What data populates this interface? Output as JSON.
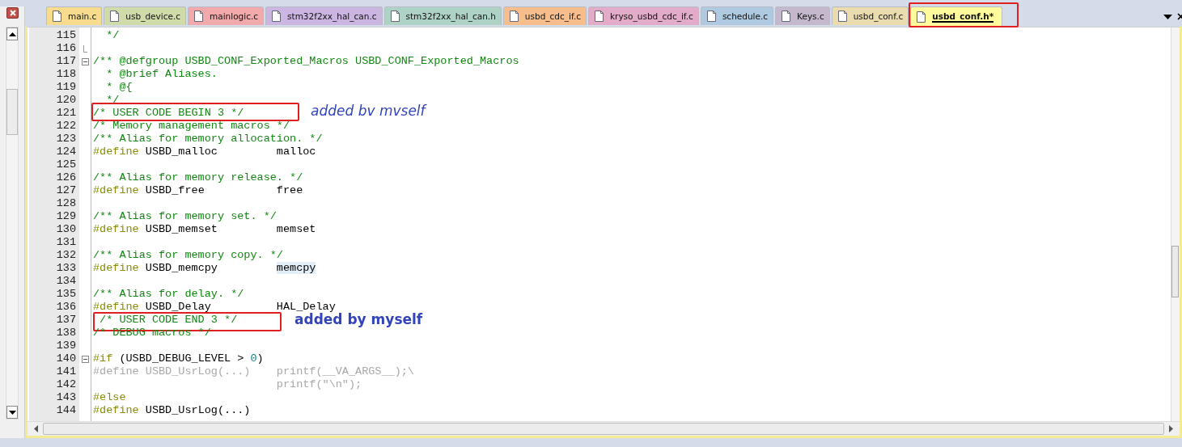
{
  "tabs": [
    {
      "label": "main.c",
      "color": "#f6dc8c",
      "selected": false,
      "marked": false
    },
    {
      "label": "usb_device.c",
      "color": "#cfdcaa",
      "selected": false,
      "marked": false
    },
    {
      "label": "mainlogic.c",
      "color": "#f2a9ab",
      "selected": false,
      "marked": false
    },
    {
      "label": "stm32f2xx_hal_can.c",
      "color": "#cbb6e2",
      "selected": false,
      "marked": false
    },
    {
      "label": "stm32f2xx_hal_can.h",
      "color": "#aed3c6",
      "selected": false,
      "marked": false
    },
    {
      "label": "usbd_cdc_if.c",
      "color": "#f7bd8a",
      "selected": false,
      "marked": false
    },
    {
      "label": "kryso_usbd_cdc_if.c",
      "color": "#e2acc8",
      "selected": false,
      "marked": false
    },
    {
      "label": "schedule.c",
      "color": "#aec9e0",
      "selected": false,
      "marked": false
    },
    {
      "label": "Keys.c",
      "color": "#c6b8cc",
      "selected": false,
      "marked": false
    },
    {
      "label": "usbd_conf.c",
      "color": "#eadcae",
      "selected": false,
      "marked": false
    },
    {
      "label": "usbd_conf.h*",
      "color": "#fdfb9c",
      "selected": true,
      "marked": true
    }
  ],
  "lines": [
    {
      "number": "115",
      "tokens": [
        {
          "kind": "comment",
          "text": "  */"
        }
      ]
    },
    {
      "number": "116",
      "fold_end": true
    },
    {
      "number": "117",
      "fold_start": true,
      "tokens": [
        {
          "kind": "comment",
          "text": "/** @defgroup USBD_CONF_Exported_Macros USBD_CONF_Exported_Macros"
        }
      ]
    },
    {
      "number": "118",
      "tokens": [
        {
          "kind": "comment",
          "text": "  * @brief Aliases."
        }
      ]
    },
    {
      "number": "119",
      "tokens": [
        {
          "kind": "comment",
          "text": "  * @{"
        }
      ]
    },
    {
      "number": "120",
      "tokens": [
        {
          "kind": "comment",
          "text": "  */"
        }
      ]
    },
    {
      "number": "121",
      "tokens": [
        {
          "kind": "comment",
          "text": "/* USER CODE BEGIN 3 */"
        }
      ],
      "note": {
        "text": "added bv mvself"
      }
    },
    {
      "number": "122",
      "tokens": [
        {
          "kind": "comment",
          "text": "/* Memory management macros */"
        }
      ]
    },
    {
      "number": "123",
      "tokens": [
        {
          "kind": "comment",
          "text": "/** Alias for memory allocation. */"
        }
      ]
    },
    {
      "number": "124",
      "tokens": [
        {
          "kind": "preproc",
          "text": "#define"
        },
        {
          "kind": "plain",
          "text": " USBD_malloc         malloc"
        }
      ]
    },
    {
      "number": "125"
    },
    {
      "number": "126",
      "tokens": [
        {
          "kind": "comment",
          "text": "/** Alias for memory release. */"
        }
      ]
    },
    {
      "number": "127",
      "tokens": [
        {
          "kind": "preproc",
          "text": "#define"
        },
        {
          "kind": "plain",
          "text": " USBD_free           free"
        }
      ]
    },
    {
      "number": "128"
    },
    {
      "number": "129",
      "tokens": [
        {
          "kind": "comment",
          "text": "/** Alias for memory set. */"
        }
      ]
    },
    {
      "number": "130",
      "tokens": [
        {
          "kind": "preproc",
          "text": "#define"
        },
        {
          "kind": "plain",
          "text": " USBD_memset         memset"
        }
      ]
    },
    {
      "number": "131"
    },
    {
      "number": "132",
      "tokens": [
        {
          "kind": "comment",
          "text": "/** Alias for memory copy. */"
        }
      ]
    },
    {
      "number": "133",
      "tokens": [
        {
          "kind": "preproc",
          "text": "#define"
        },
        {
          "kind": "plain",
          "text": " USBD_memcpy         "
        },
        {
          "kind": "plain",
          "text": "memcpy",
          "highlighted": true
        }
      ]
    },
    {
      "number": "134"
    },
    {
      "number": "135",
      "tokens": [
        {
          "kind": "comment",
          "text": "/** Alias for delay. */"
        }
      ]
    },
    {
      "number": "136",
      "tokens": [
        {
          "kind": "preproc",
          "text": "#define"
        },
        {
          "kind": "plain",
          "text": " USBD_Delay          HAL_Delay"
        }
      ]
    },
    {
      "number": "137",
      "tokens": [
        {
          "kind": "comment",
          "text": " /* USER CODE END 3 */"
        }
      ],
      "note": {
        "text": "added by myself"
      }
    },
    {
      "number": "138",
      "tokens": [
        {
          "kind": "comment",
          "text": "/* DEBUG macros */"
        }
      ]
    },
    {
      "number": "139"
    },
    {
      "number": "140",
      "fold_start": true,
      "tokens": [
        {
          "kind": "preproc",
          "text": "#if"
        },
        {
          "kind": "plain",
          "text": " (USBD_DEBUG_LEVEL > "
        },
        {
          "kind": "number",
          "text": "0"
        },
        {
          "kind": "plain",
          "text": ")"
        }
      ]
    },
    {
      "number": "141",
      "tokens": [
        {
          "kind": "inactive",
          "text": "#define USBD_UsrLog(...)    printf(__VA_ARGS__);\\"
        }
      ]
    },
    {
      "number": "142",
      "tokens": [
        {
          "kind": "inactive",
          "text": "                            printf(\"\\n\");"
        }
      ]
    },
    {
      "number": "143",
      "tokens": [
        {
          "kind": "preproc",
          "text": "#else"
        }
      ]
    },
    {
      "number": "144",
      "tokens": [
        {
          "kind": "preproc",
          "text": "#define"
        },
        {
          "kind": "plain",
          "text": " USBD_UsrLog(...)"
        }
      ]
    }
  ]
}
